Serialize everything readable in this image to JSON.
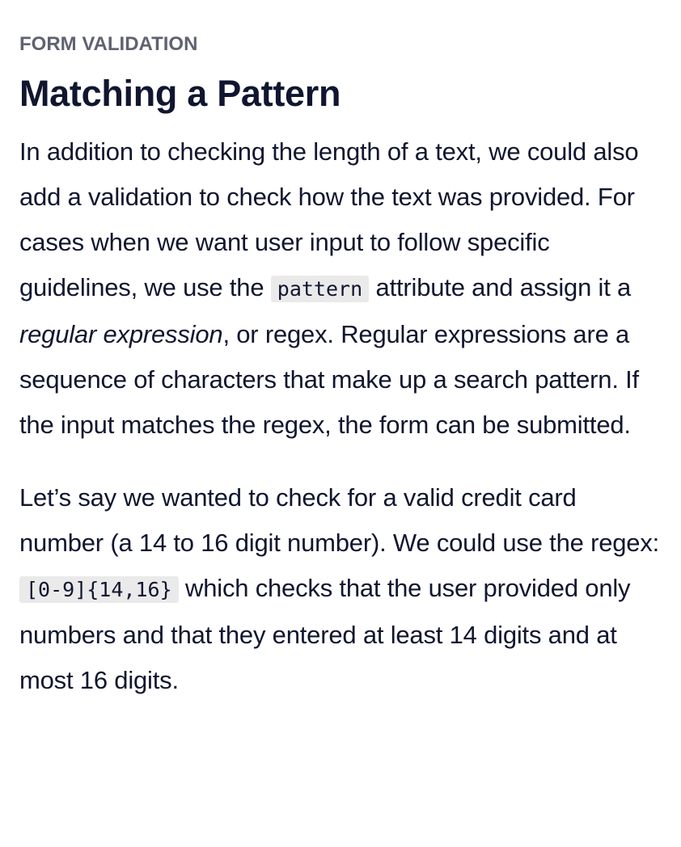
{
  "section_label": "FORM VALIDATION",
  "title": "Matching a Pattern",
  "paragraph1": {
    "text_before_code": "In addition to checking the length of a text, we could also add a validation to check how the text was provided. For cases when we want user input to follow specific guidelines, we use the ",
    "code": "pattern",
    "text_after_code": " attribute and assign it a ",
    "emphasis": "regular expression",
    "text_end": ", or regex. Regular expressions are a sequence of characters that make up a search pattern. If the input matches the regex, the form can be submitted."
  },
  "paragraph2": {
    "text_before_code": "Let’s say we wanted to check for a valid credit card number (a 14 to 16 digit number). We could use the regex: ",
    "code": "[0-9]{14,16}",
    "text_after_code": " which checks that the user provided only numbers and that they entered at least 14 digits and at most 16 digits."
  }
}
